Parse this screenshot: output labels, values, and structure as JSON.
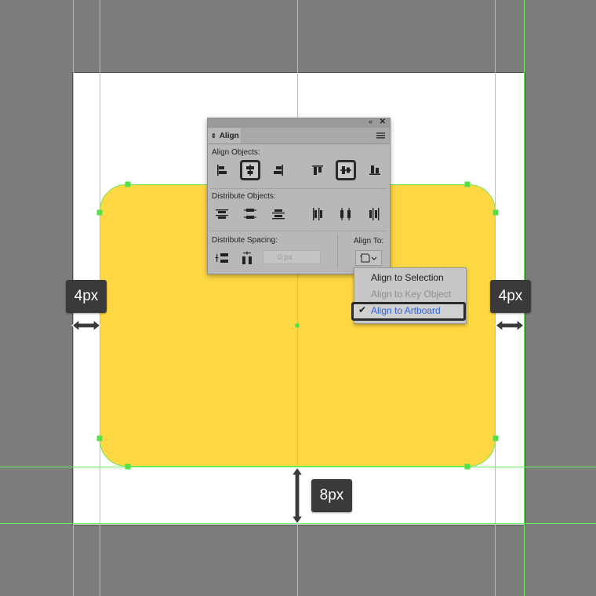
{
  "colors": {
    "canvas_bg": "#7c7c7c",
    "artboard": "#ffffff",
    "shape_fill": "#fdd843",
    "guide": "#6ff268",
    "anchor": "#55e04a",
    "tag_bg": "#3a3a3a",
    "panel_bg": "#b8b8b8",
    "menu_highlight_text": "#2f64d6"
  },
  "measurements": {
    "left_gap": "4px",
    "right_gap": "4px",
    "bottom_gap": "8px"
  },
  "align_panel": {
    "tab_label": "Align",
    "align_objects_label": "Align Objects:",
    "distribute_objects_label": "Distribute Objects:",
    "distribute_spacing_label": "Distribute Spacing:",
    "align_to_label": "Align To:",
    "spacing_value": "0 px",
    "icons": {
      "align_objects": [
        "horizontal-align-left-icon",
        "horizontal-align-center-icon",
        "horizontal-align-right-icon",
        "vertical-align-top-icon",
        "vertical-align-center-icon",
        "vertical-align-bottom-icon"
      ],
      "distribute_objects": [
        "vertical-distribute-top-icon",
        "vertical-distribute-center-icon",
        "vertical-distribute-bottom-icon",
        "horizontal-distribute-left-icon",
        "horizontal-distribute-center-icon",
        "horizontal-distribute-right-icon"
      ],
      "distribute_spacing": [
        "vertical-distribute-space-icon",
        "horizontal-distribute-space-icon"
      ],
      "selected": [
        "horizontal-align-center-icon",
        "vertical-align-center-icon"
      ]
    }
  },
  "align_to_menu": {
    "items": [
      {
        "label": "Align to Selection",
        "enabled": true,
        "checked": false
      },
      {
        "label": "Align to Key Object",
        "enabled": false,
        "checked": false
      },
      {
        "label": "Align to Artboard",
        "enabled": true,
        "checked": true
      }
    ],
    "check_glyph": "✔"
  }
}
